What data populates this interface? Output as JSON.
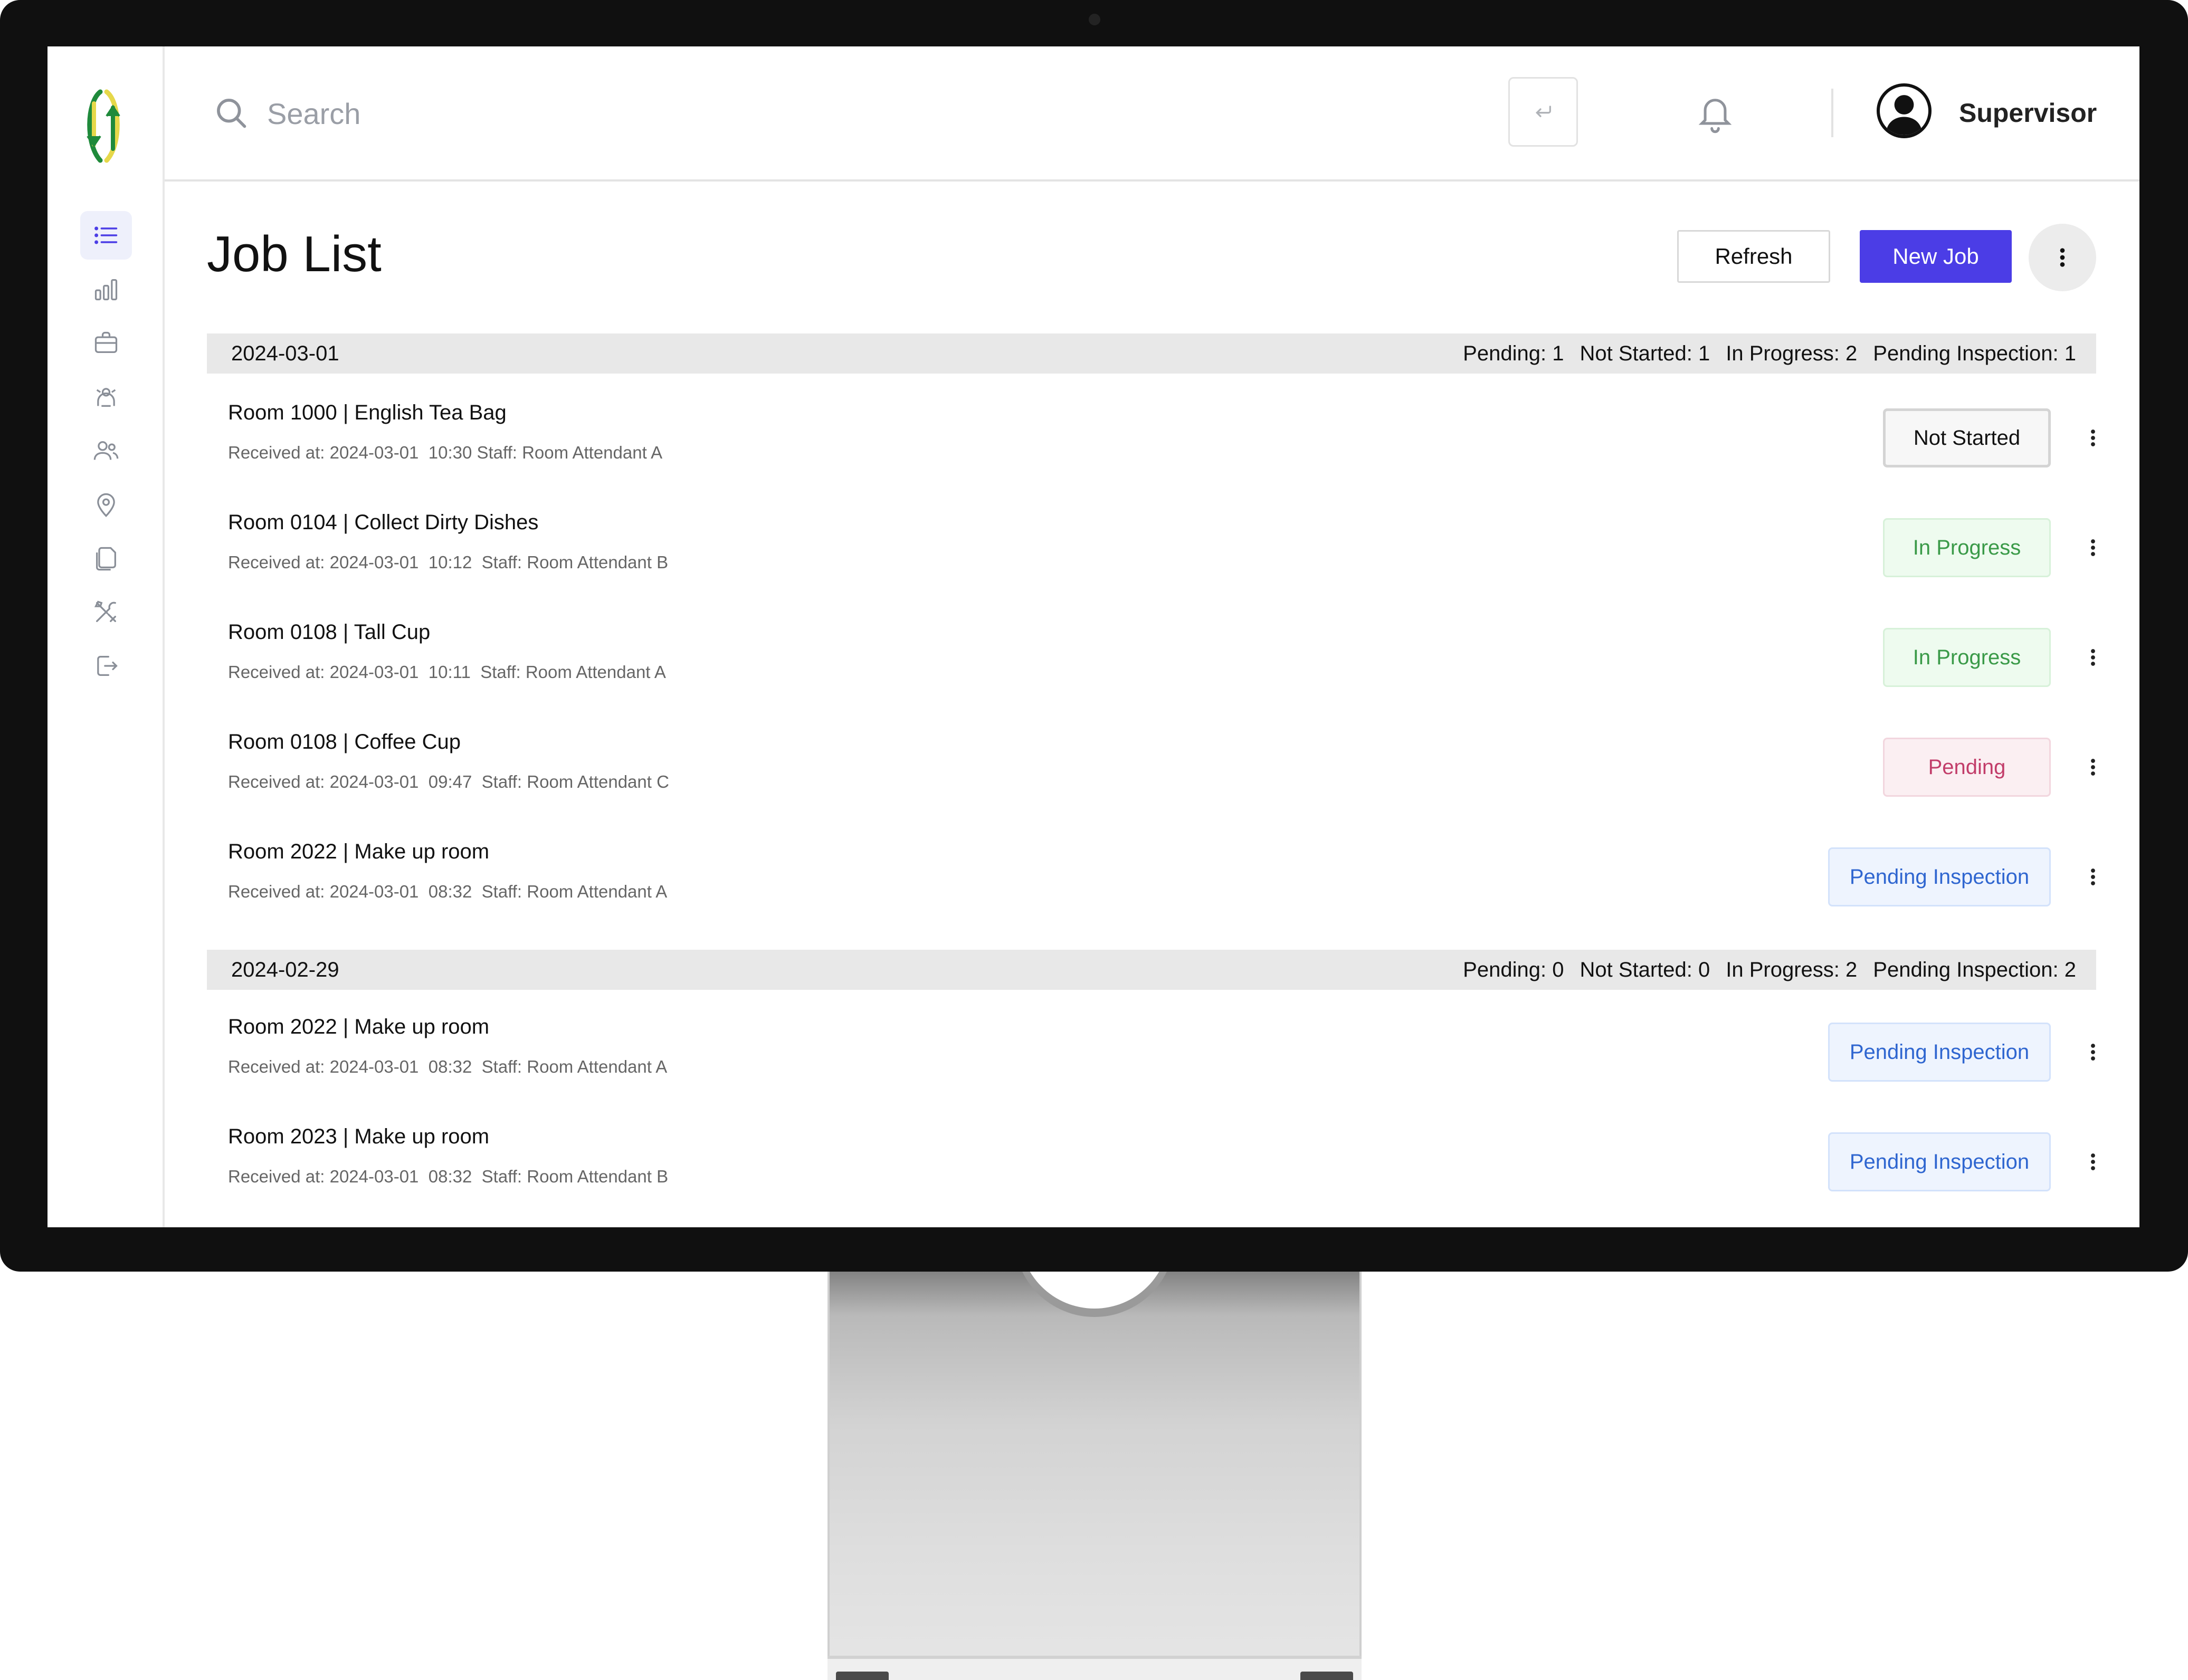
{
  "colors": {
    "accent": "#4b3de6",
    "status_in_progress": "#3a9a48",
    "status_pending": "#c23d6a",
    "status_pending_inspection": "#2f66d0",
    "logo_green": "#1f8a3b",
    "logo_yellow": "#e6d84a"
  },
  "sidebar": {
    "items": [
      {
        "icon": "list-icon",
        "active": true
      },
      {
        "icon": "bar-chart-icon"
      },
      {
        "icon": "briefcase-icon"
      },
      {
        "icon": "room-service-icon"
      },
      {
        "icon": "users-icon"
      },
      {
        "icon": "location-pin-icon"
      },
      {
        "icon": "documents-icon"
      },
      {
        "icon": "tools-icon"
      },
      {
        "icon": "logout-icon"
      }
    ]
  },
  "header": {
    "search_placeholder": "Search",
    "user_name": "Supervisor"
  },
  "page": {
    "title": "Job List",
    "refresh_label": "Refresh",
    "new_job_label": "New Job"
  },
  "groups": [
    {
      "date": "2024-03-01",
      "stats": [
        "Pending: 1",
        "Not Started: 1",
        "In Progress: 2",
        "Pending Inspection: 1"
      ],
      "jobs": [
        {
          "title": "Room 1000 | English Tea Bag",
          "meta": "Received at: 2024-03-01  10:30 Staff: Room Attendant A",
          "status": "Not Started"
        },
        {
          "title": "Room 0104 | Collect Dirty Dishes",
          "meta": "Received at: 2024-03-01  10:12  Staff: Room Attendant B",
          "status": "In Progress"
        },
        {
          "title": "Room 0108 | Tall Cup",
          "meta": "Received at: 2024-03-01  10:11  Staff: Room Attendant A",
          "status": "In Progress"
        },
        {
          "title": "Room 0108 | Coffee Cup",
          "meta": "Received at: 2024-03-01  09:47  Staff: Room Attendant C",
          "status": "Pending"
        },
        {
          "title": "Room 2022 | Make up room",
          "meta": "Received at: 2024-03-01  08:32  Staff: Room Attendant A",
          "status": "Pending Inspection"
        }
      ]
    },
    {
      "date": "2024-02-29",
      "stats": [
        "Pending: 0",
        "Not Started: 0",
        "In Progress: 2",
        "Pending Inspection: 2"
      ],
      "jobs": [
        {
          "title": "Room 2022 | Make up room",
          "meta": "Received at: 2024-03-01  08:32  Staff: Room Attendant A",
          "status": "Pending Inspection"
        },
        {
          "title": "Room 2023 | Make up room",
          "meta": "Received at: 2024-03-01  08:32  Staff: Room Attendant B",
          "status": "Pending Inspection"
        }
      ]
    }
  ]
}
